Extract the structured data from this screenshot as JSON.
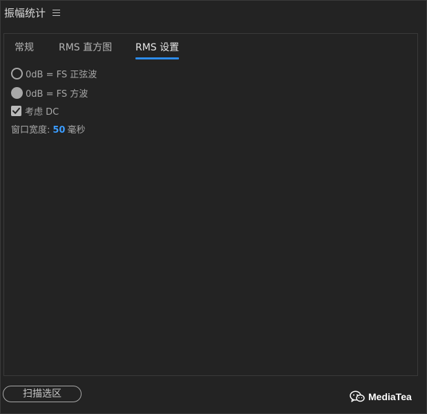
{
  "window": {
    "title": "振幅统计"
  },
  "tabs": [
    {
      "label": "常规",
      "active": false
    },
    {
      "label": "RMS 直方图",
      "active": false
    },
    {
      "label": "RMS 设置",
      "active": true
    }
  ],
  "rms_settings": {
    "reference_options": [
      {
        "label": "0dB = FS 正弦波",
        "selected": false
      },
      {
        "label": "0dB = FS 方波",
        "selected": true
      }
    ],
    "consider_dc": {
      "label": "考虑 DC",
      "checked": true
    },
    "window_width": {
      "label": "窗口宽度:",
      "value": "50",
      "unit": "毫秒"
    }
  },
  "footer": {
    "scan_button_label": "扫描选区"
  },
  "watermark": {
    "text": "MediaTea",
    "icon": "wechat-icon"
  },
  "colors": {
    "accent": "#2d8ceb",
    "value_blue": "#3b9cff",
    "background": "#232323"
  }
}
